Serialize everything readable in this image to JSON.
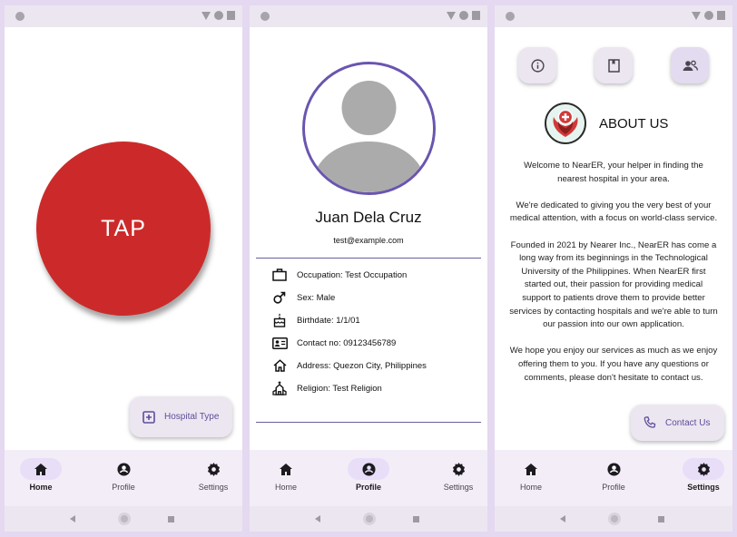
{
  "home": {
    "tap_label": "TAP",
    "fab_label": "Hospital Type"
  },
  "profile": {
    "name": "Juan Dela Cruz",
    "email": "test@example.com",
    "rows": [
      {
        "icon": "briefcase-icon",
        "text": "Occupation: Test Occupation"
      },
      {
        "icon": "male-icon",
        "text": "Sex: Male"
      },
      {
        "icon": "cake-icon",
        "text": "Birthdate: 1/1/01"
      },
      {
        "icon": "contact-card-icon",
        "text": "Contact no: 09123456789"
      },
      {
        "icon": "home-outline-icon",
        "text": "Address: Quezon City, Philippines"
      },
      {
        "icon": "church-icon",
        "text": "Religion: Test Religion"
      }
    ]
  },
  "about": {
    "title": "ABOUT US",
    "paragraphs": [
      "Welcome to NearER, your helper in finding the nearest hospital in your area.",
      "We're dedicated to giving you the very best of your medical attention, with a focus on world-class service.",
      "Founded in 2021 by Nearer Inc., NearER has come a long way from its beginnings in the Technological University of the Philippines. When NearER first started out, their passion for providing medical support to patients drove them to provide better services by contacting hospitals and we're able to turn our passion into our own application.",
      "We hope you enjoy our services as much as we enjoy offering them to you. If you have any questions or comments, please don't hesitate to contact us."
    ],
    "fab_label": "Contact Us",
    "top_icons": [
      "info-icon",
      "book-icon",
      "people-icon"
    ]
  },
  "nav": {
    "home": "Home",
    "profile": "Profile",
    "settings": "Settings"
  },
  "colors": {
    "tap_red": "#cc2a2a",
    "accent_purple": "#6a55b0",
    "nav_active_pill": "#e8def8",
    "fab_text": "#5d4e99"
  }
}
